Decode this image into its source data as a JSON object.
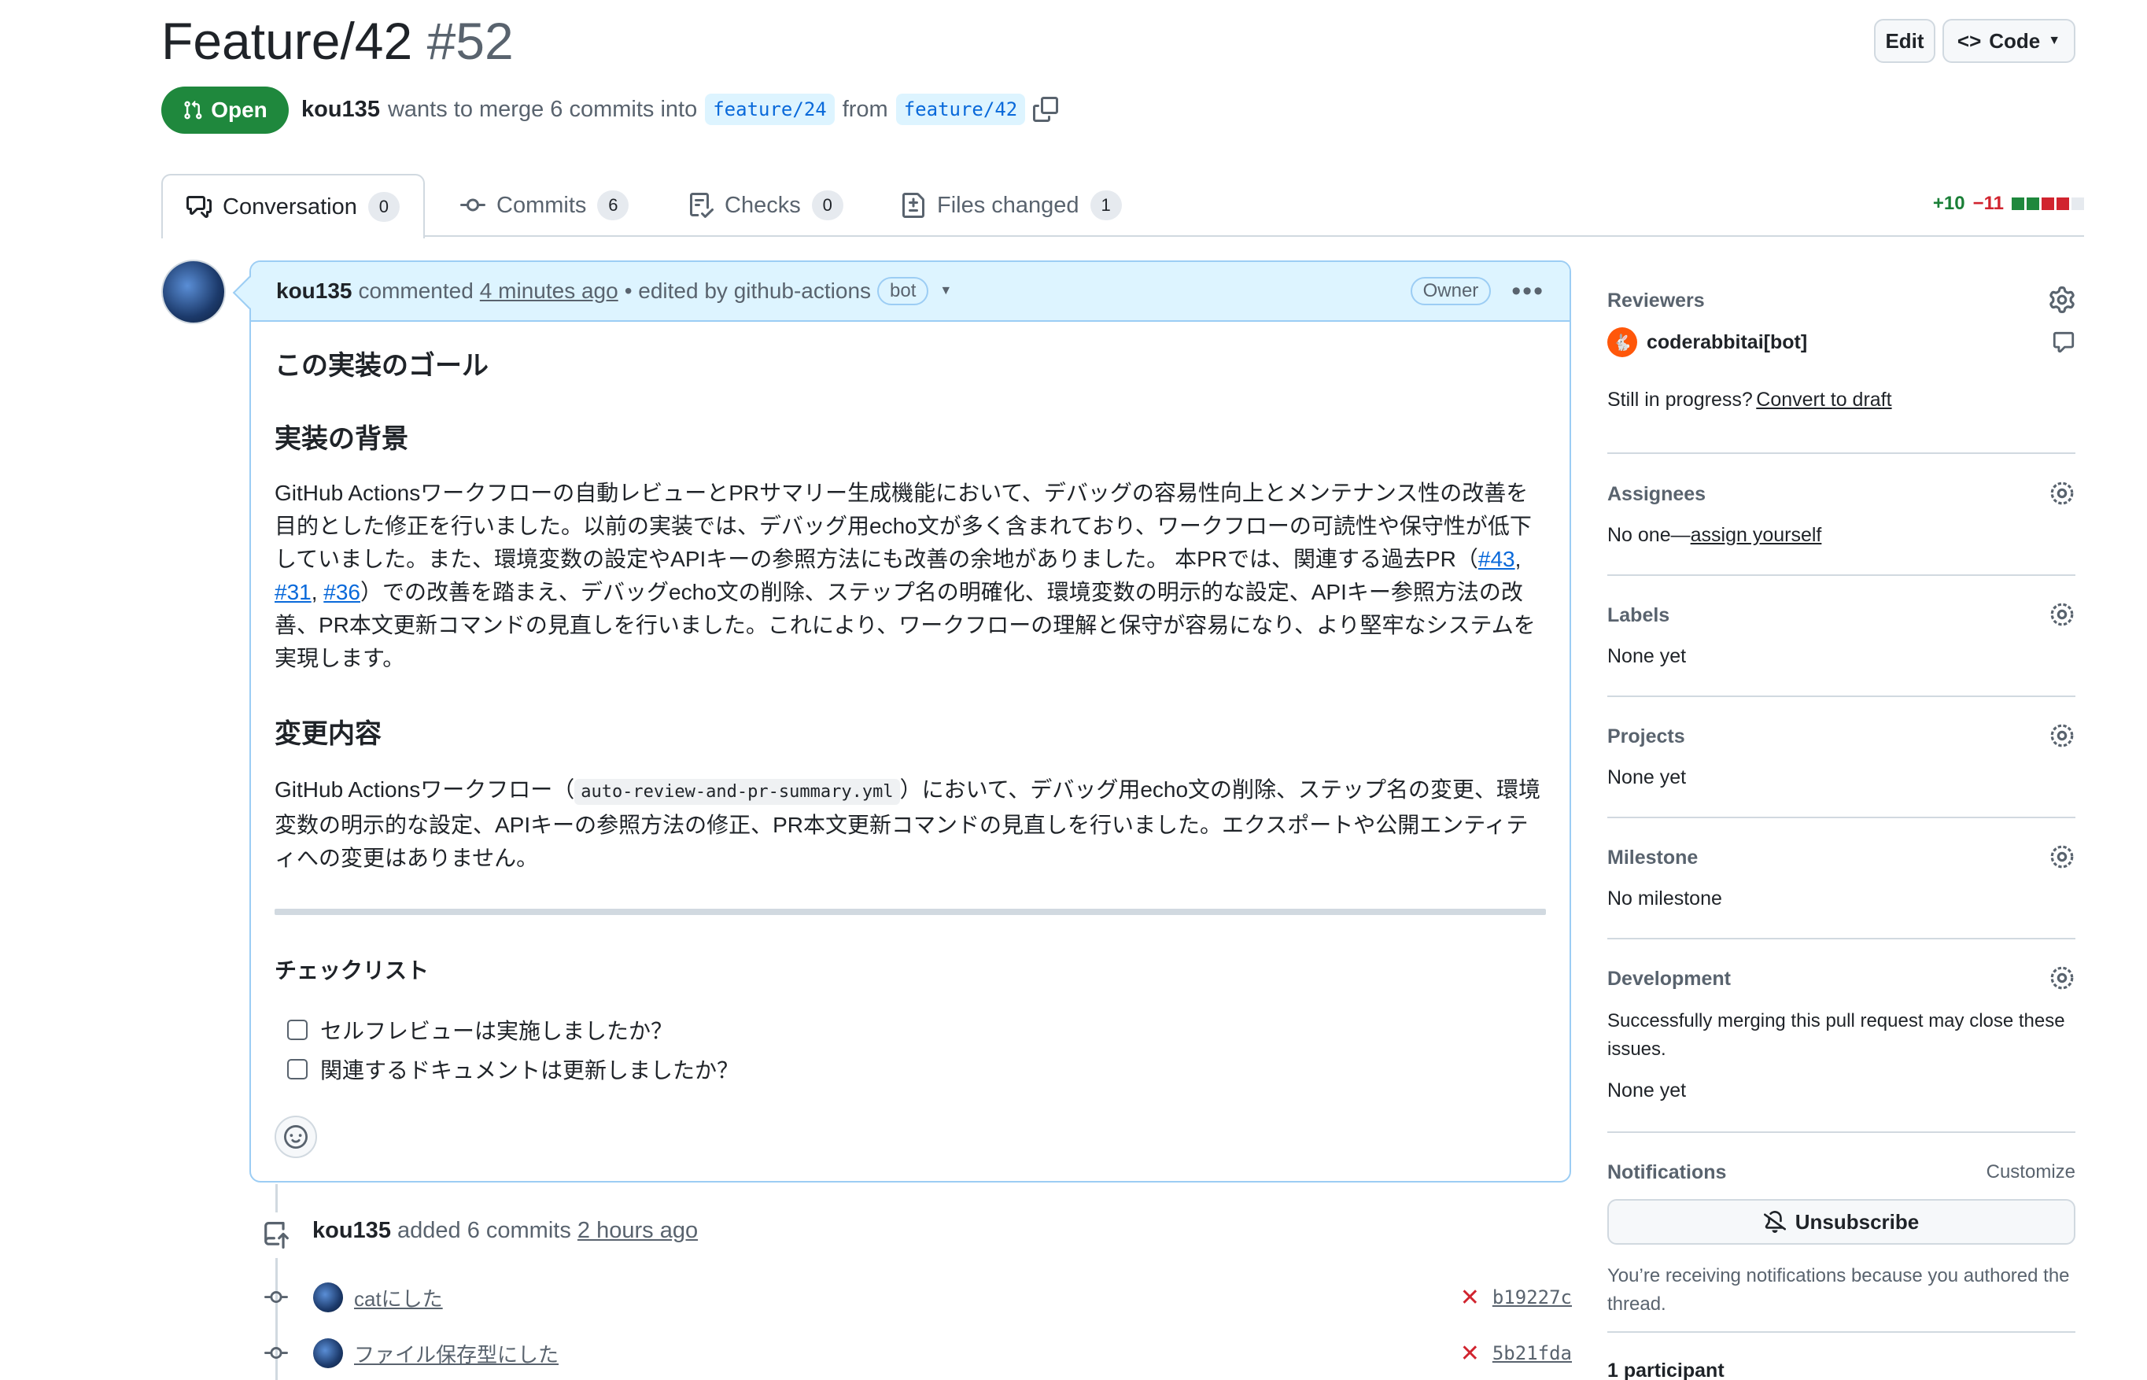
{
  "pr": {
    "title": "Feature/42",
    "number": "#52",
    "state": "Open",
    "author": "kou135",
    "merge_text": "wants to merge 6 commits into",
    "base_branch": "feature/24",
    "from_text": "from",
    "head_branch": "feature/42"
  },
  "header": {
    "edit_label": "Edit",
    "code_label": "Code"
  },
  "tabs": [
    {
      "label": "Conversation",
      "count": "0"
    },
    {
      "label": "Commits",
      "count": "6"
    },
    {
      "label": "Checks",
      "count": "0"
    },
    {
      "label": "Files changed",
      "count": "1"
    }
  ],
  "diffstat": {
    "additions": "+10",
    "deletions": "−11"
  },
  "comment": {
    "author": "kou135",
    "commented": "commented",
    "time": "4 minutes ago",
    "edited": "• edited by github-actions",
    "bot_badge": "bot",
    "owner_badge": "Owner",
    "h_goal": "この実装のゴール",
    "h_background": "実装の背景",
    "p_background_1": "GitHub Actionsワークフローの自動レビューとPRサマリー生成機能において、デバッグの容易性向上とメンテナンス性の改善を目的とした修正を行いました。以前の実装では、デバッグ用echo文が多く含まれており、ワークフローの可読性や保守性が低下していました。また、環境変数の設定やAPIキーの参照方法にも改善の余地がありました。 本PRでは、関連する過去PR（",
    "ref_43": "#43",
    "sep1": ", ",
    "ref_31": "#31",
    "sep2": ", ",
    "ref_36": "#36",
    "p_background_2": "）での改善を踏まえ、デバッグecho文の削除、ステップ名の明確化、環境変数の明示的な設定、APIキー参照方法の改善、PR本文更新コマンドの見直しを行いました。これにより、ワークフローの理解と保守が容易になり、より堅牢なシステムを実現します。",
    "h_changes": "変更内容",
    "p_changes_1": "GitHub Actionsワークフロー（",
    "file_code": "auto-review-and-pr-summary.yml",
    "p_changes_2": "）において、デバッグ用echo文の削除、ステップ名の変更、環境変数の明示的な設定、APIキーの参照方法の修正、PR本文更新コマンドの見直しを行いました。エクスポートや公開エンティティへの変更はありません。",
    "h_checklist": "チェックリスト",
    "checklist": [
      "セルフレビューは実施しましたか？",
      "関連するドキュメントは更新しましたか？"
    ]
  },
  "timeline": {
    "author": "kou135",
    "action": "added 6 commits",
    "time": "2 hours ago",
    "commits": [
      {
        "message": "catにした",
        "sha": "b19227c"
      },
      {
        "message": "ファイル保存型にした",
        "sha": "5b21fda"
      }
    ]
  },
  "sidebar": {
    "reviewers_title": "Reviewers",
    "reviewer": "coderabbitai[bot]",
    "still_in_progress": "Still in progress?",
    "convert_to_draft": "Convert to draft",
    "assignees_title": "Assignees",
    "assignees_none": "No one—",
    "assign_yourself": "assign yourself",
    "labels_title": "Labels",
    "labels_value": "None yet",
    "projects_title": "Projects",
    "projects_value": "None yet",
    "milestone_title": "Milestone",
    "milestone_value": "No milestone",
    "development_title": "Development",
    "development_text": "Successfully merging this pull request may close these issues.",
    "development_value": "None yet",
    "notifications_title": "Notifications",
    "customize": "Customize",
    "unsubscribe": "Unsubscribe",
    "notify_reason": "You’re receiving notifications because you authored the thread.",
    "participants": "1 participant"
  },
  "colors": {
    "open_green": "#1f883d",
    "link_blue": "#0969da",
    "deletion_red": "#d1242f"
  }
}
